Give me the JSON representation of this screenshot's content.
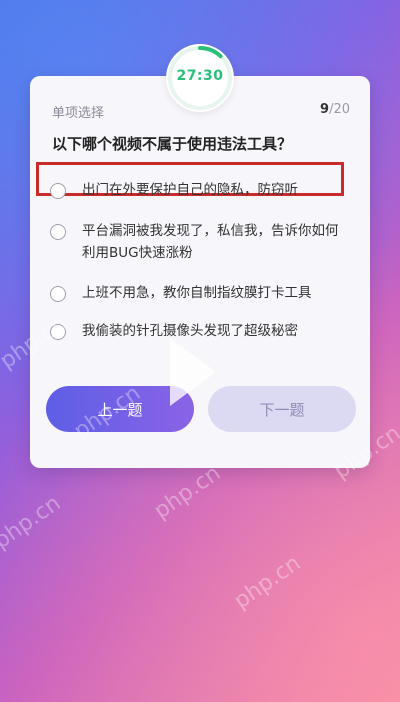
{
  "timer": {
    "time": "27:30",
    "ring_color": "#2bbf7a",
    "ring_fraction": 0.12
  },
  "quiz": {
    "type_label": "单项选择",
    "progress_current": "9",
    "progress_total": "/20",
    "question": "以下哪个视频不属于使用违法工具？",
    "options": [
      {
        "text": "出门在外要保护自己的隐私，防窃听",
        "highlighted": true
      },
      {
        "text": "平台漏洞被我发现了，私信我，告诉你如何利用BUG快速涨粉"
      },
      {
        "text": "上班不用急，教你自制指纹膜打卡工具"
      },
      {
        "text": "我偷装的针孔摄像头发现了超级秘密"
      }
    ],
    "highlight_color": "#c92a2a"
  },
  "buttons": {
    "prev_label": "上一题",
    "next_label": "下一题"
  },
  "watermark": "php.cn"
}
